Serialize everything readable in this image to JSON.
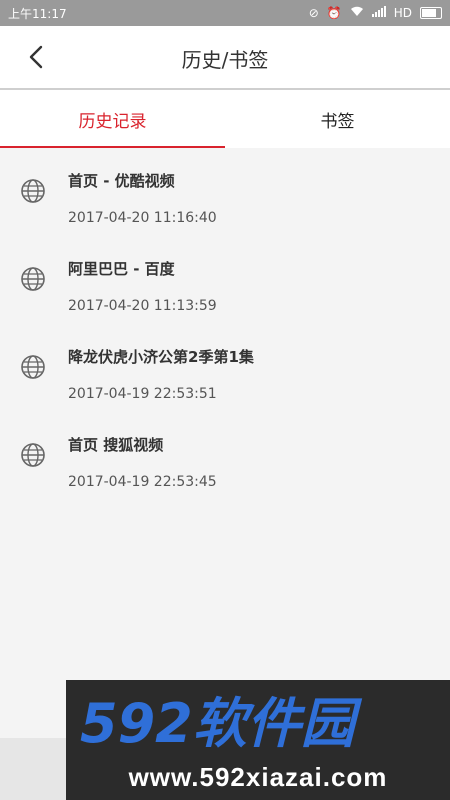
{
  "status_bar": {
    "time": "上午11:17",
    "network": "HD"
  },
  "app_bar": {
    "title": "历史/书签"
  },
  "tabs": [
    {
      "label": "历史记录",
      "active": true
    },
    {
      "label": "书签",
      "active": false
    }
  ],
  "history": [
    {
      "title": "首页 - 优酷视频",
      "time": "2017-04-20 11:16:40"
    },
    {
      "title": "阿里巴巴 - 百度",
      "time": "2017-04-20 11:13:59"
    },
    {
      "title": "降龙伏虎小济公第2季第1集",
      "time": "2017-04-19 22:53:51"
    },
    {
      "title": "首页 搜狐视频",
      "time": "2017-04-19 22:53:45"
    }
  ],
  "watermark": {
    "logo_text": "592软件园",
    "url": "www.592xiazai.com"
  },
  "colors": {
    "accent": "#d9232d",
    "watermark_blue": "#2f6fd8"
  }
}
